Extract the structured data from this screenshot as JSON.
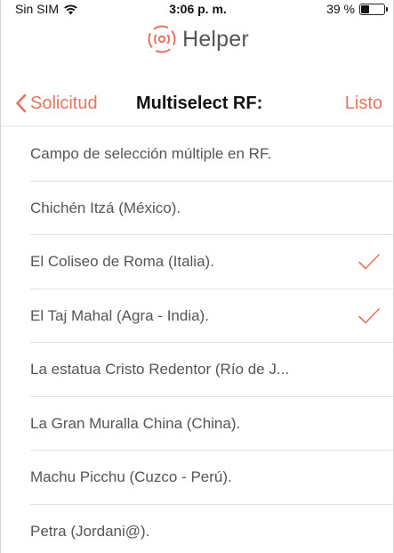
{
  "status_bar": {
    "carrier": "Sin SIM",
    "time": "3:06 p. m.",
    "battery_label": "39 %",
    "battery_level": 0.39
  },
  "brand": {
    "name": "Helper",
    "logo_icon": "radar-signal-icon"
  },
  "nav": {
    "back_label": "Solicitud",
    "title": "Multiselect RF:",
    "done_label": "Listo"
  },
  "colors": {
    "accent": "#e8735f",
    "separator": "#e0e0e0",
    "label": "#555555"
  },
  "list": {
    "items": [
      {
        "label": "Campo de selección múltiple en RF.",
        "checked": false
      },
      {
        "label": "Chichén Itzá (México).",
        "checked": false
      },
      {
        "label": "El Coliseo de Roma (Italia).",
        "checked": true
      },
      {
        "label": "El Taj Mahal (Agra - India).",
        "checked": true
      },
      {
        "label": "La estatua Cristo Redentor (Río de J...",
        "checked": false
      },
      {
        "label": "La Gran Muralla China (China).",
        "checked": false
      },
      {
        "label": "Machu Picchu (Cuzco - Perú).",
        "checked": false
      },
      {
        "label": "Petra (Jordani@).",
        "checked": false
      }
    ]
  }
}
